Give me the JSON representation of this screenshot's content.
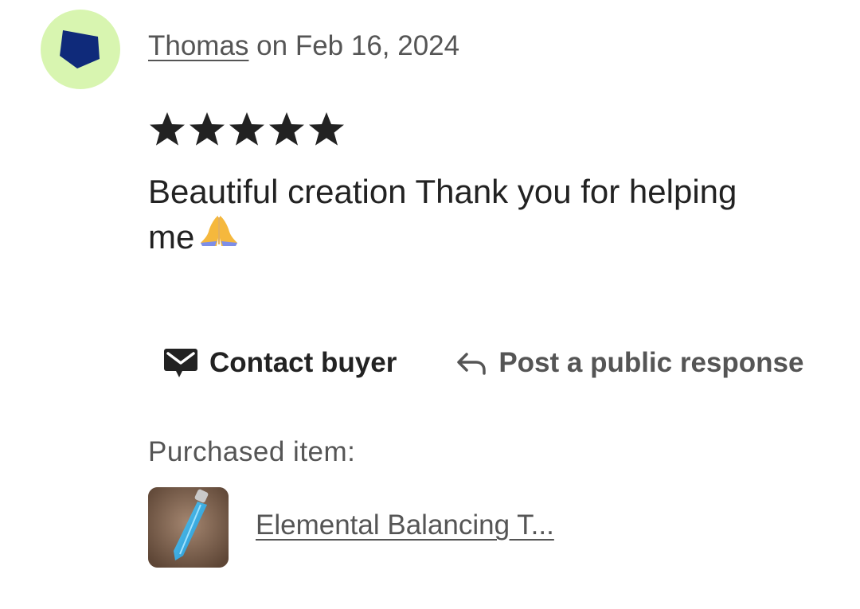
{
  "review": {
    "reviewer_name": "Thomas",
    "date_text": "on Feb 16, 2024",
    "rating": 5,
    "rating_max": 5,
    "text": "Beautiful creation Thank you for helping me",
    "emoji": "folded-hands-emoji"
  },
  "actions": {
    "contact_label": "Contact buyer",
    "contact_icon": "mail-icon",
    "respond_label": "Post a public response",
    "respond_icon": "reply-arrow-icon"
  },
  "purchase": {
    "label": "Purchased item:",
    "item_title": "Elemental Balancing T..."
  },
  "colors": {
    "avatar_bg": "#d8f5b0",
    "avatar_shape": "#0f2a7a",
    "star": "#222222",
    "muted_text": "#555555"
  }
}
